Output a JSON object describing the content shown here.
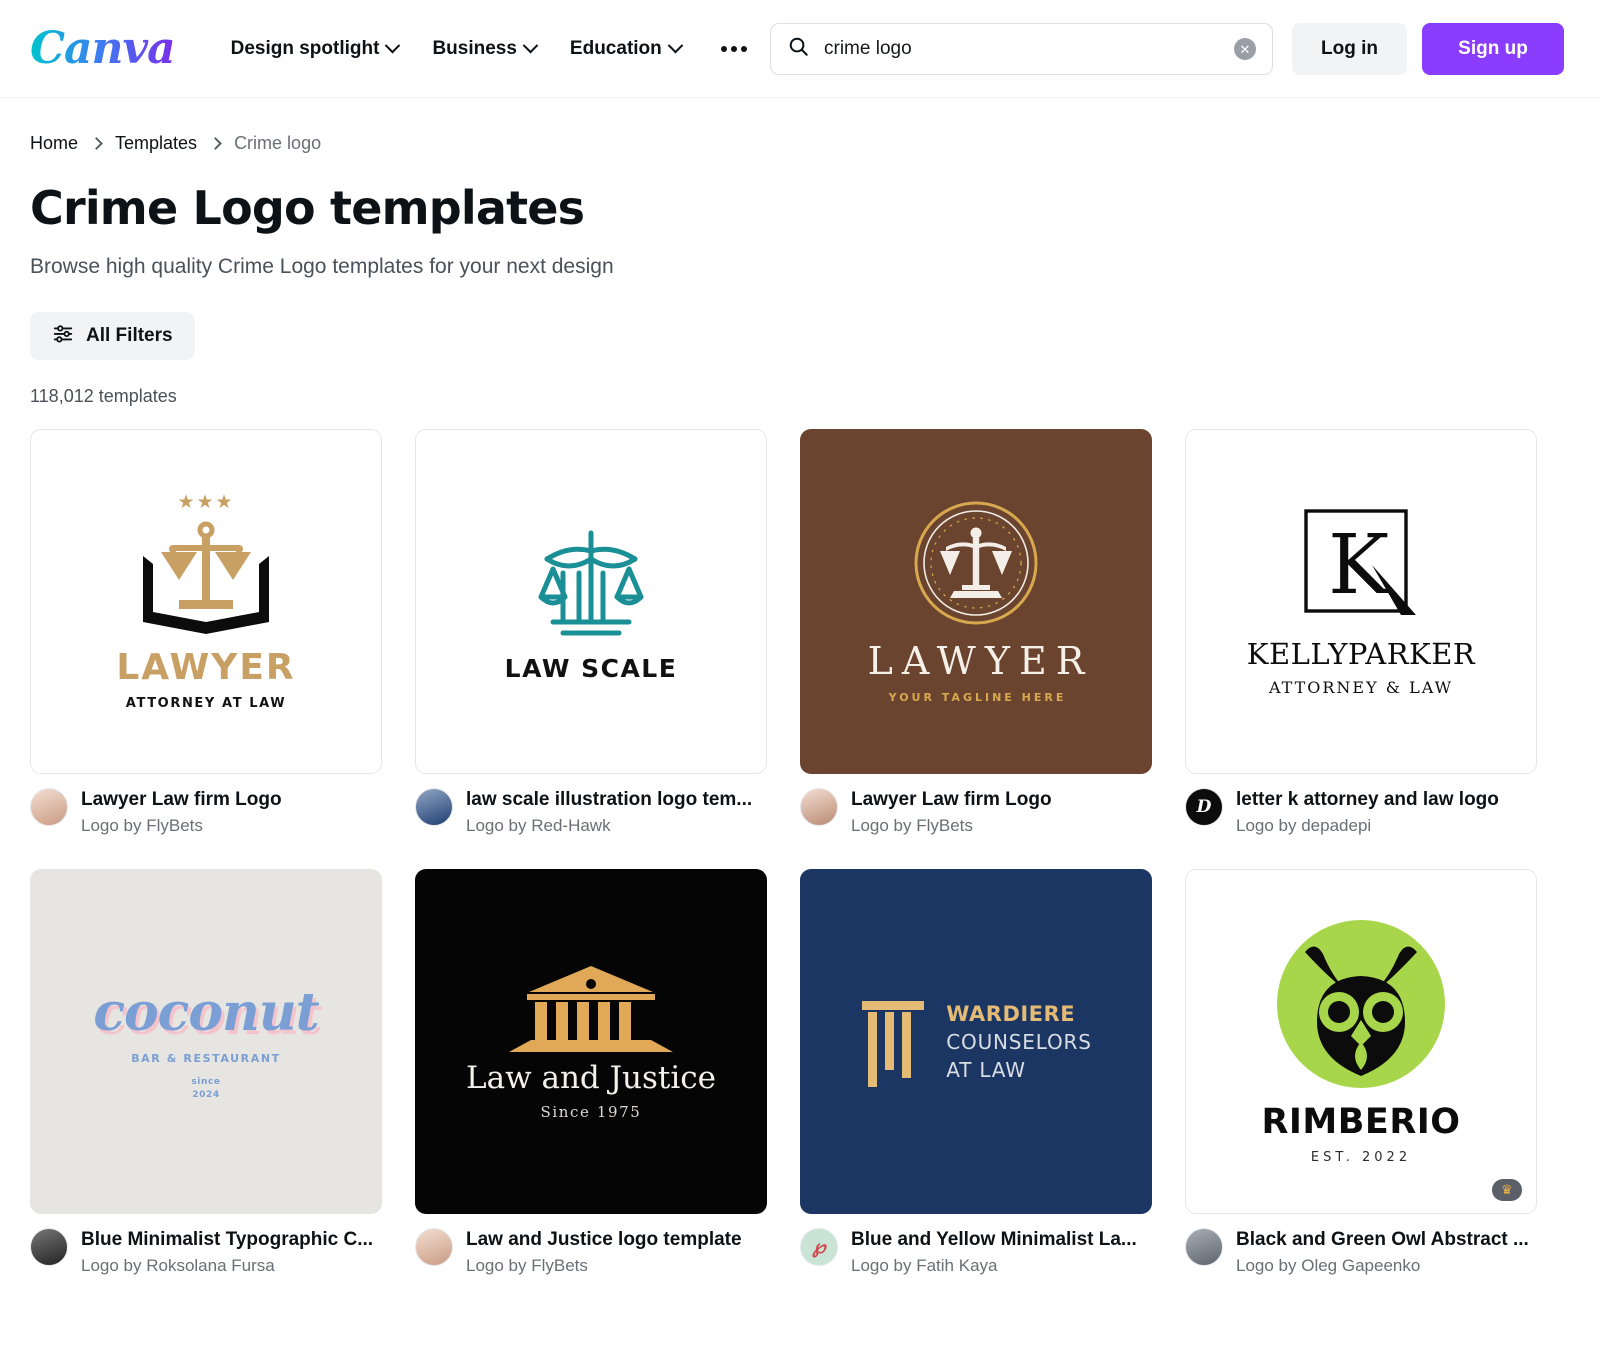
{
  "header": {
    "logo_text": "Canva",
    "nav": [
      {
        "label": "Design spotlight",
        "has_caret": true
      },
      {
        "label": "Business",
        "has_caret": true
      },
      {
        "label": "Education",
        "has_caret": true
      }
    ],
    "more_icon": "ellipsis-icon",
    "search": {
      "value": "crime logo",
      "placeholder": "Search",
      "icon": "search-icon",
      "clear_icon": "close-circle-icon",
      "clear_glyph": "✕"
    },
    "login_label": "Log in",
    "signup_label": "Sign up",
    "signup_color": "#8b3dff"
  },
  "breadcrumb": [
    {
      "label": "Home",
      "current": false
    },
    {
      "label": "Templates",
      "current": false
    },
    {
      "label": "Crime logo",
      "current": true
    }
  ],
  "title": "Crime Logo templates",
  "subtitle": "Browse high quality Crime Logo templates for your next design",
  "filters": {
    "label": "All Filters",
    "icon": "sliders-icon"
  },
  "result_count": "118,012 templates",
  "cards": [
    {
      "title": "Lawyer Law firm Logo",
      "author": "Logo by FlyBets",
      "bg": "#ffffff",
      "bordered": true,
      "premium": false,
      "art": {
        "kind": "scales-book-gold",
        "stars": "★★★",
        "word": "LAWYER",
        "sub": "ATTORNEY AT LAW",
        "accent": "#c9a063"
      },
      "avatar": {
        "kind": "photo",
        "tone": "#d8b8a8",
        "initial": ""
      }
    },
    {
      "title": "law scale illustration logo tem...",
      "author": "Logo by Red-Hawk",
      "bg": "#ffffff",
      "bordered": true,
      "premium": false,
      "art": {
        "kind": "scales-teal",
        "word": "LAW SCALE",
        "accent": "#1a8f96"
      },
      "avatar": {
        "kind": "photo",
        "tone": "#29487d",
        "initial": ""
      }
    },
    {
      "title": "Lawyer Law firm Logo",
      "author": "Logo by FlyBets",
      "bg": "#6b4430",
      "bordered": false,
      "premium": false,
      "art": {
        "kind": "scales-emblem-brown",
        "word": "LAWYER",
        "sub": "YOUR TAGLINE HERE",
        "accent": "#d8a84e"
      },
      "avatar": {
        "kind": "photo",
        "tone": "#d8b8a8",
        "initial": ""
      }
    },
    {
      "title": "letter k attorney and law logo",
      "author": "Logo by depadepi",
      "bg": "#ffffff",
      "bordered": true,
      "premium": false,
      "art": {
        "kind": "letter-k-square",
        "letter": "K",
        "word": "KELLYPARKER",
        "sub": "ATTORNEY & LAW",
        "accent": "#111111"
      },
      "avatar": {
        "kind": "initial",
        "tone": "#0c0c0c",
        "initial": "D"
      }
    },
    {
      "title": "Blue Minimalist Typographic C...",
      "author": "Logo by Roksolana Fursa",
      "bg": "#e6e5e1",
      "bordered": false,
      "premium": false,
      "art": {
        "kind": "coconut-script",
        "word": "coconut",
        "sub": "BAR & RESTAURANT",
        "since_line1": "since",
        "since_line2": "2024",
        "accent": "#7b9ed4"
      },
      "avatar": {
        "kind": "photo",
        "tone": "#3b3b3b",
        "initial": ""
      }
    },
    {
      "title": "Law and Justice logo template",
      "author": "Logo by FlyBets",
      "bg": "#050505",
      "bordered": false,
      "premium": false,
      "art": {
        "kind": "courthouse-gold",
        "word": "Law and Justice",
        "sub": "Since 1975",
        "accent": "#e0a857"
      },
      "avatar": {
        "kind": "photo",
        "tone": "#d8b8a8",
        "initial": ""
      }
    },
    {
      "title": "Blue and Yellow Minimalist La...",
      "author": "Logo by Fatih Kaya",
      "bg": "#1b3663",
      "bordered": false,
      "premium": false,
      "art": {
        "kind": "pillar-wardiere",
        "line1": "WARDIERE",
        "line2": "COUNSELORS",
        "line3": "AT LAW",
        "accent": "#e3bb75"
      },
      "avatar": {
        "kind": "logo",
        "tone": "#c9e4d4",
        "initial": "℘"
      }
    },
    {
      "title": "Black and Green Owl Abstract ...",
      "author": "Logo by Oleg Gapeenko",
      "bg": "#ffffff",
      "bordered": true,
      "premium": true,
      "premium_icon": "crown-icon",
      "premium_glyph": "♛",
      "art": {
        "kind": "owl-green",
        "word": "RIMBERIO",
        "sub": "EST. 2022",
        "accent": "#a8d64a"
      },
      "avatar": {
        "kind": "photo",
        "tone": "#8a8f96",
        "initial": ""
      }
    }
  ]
}
